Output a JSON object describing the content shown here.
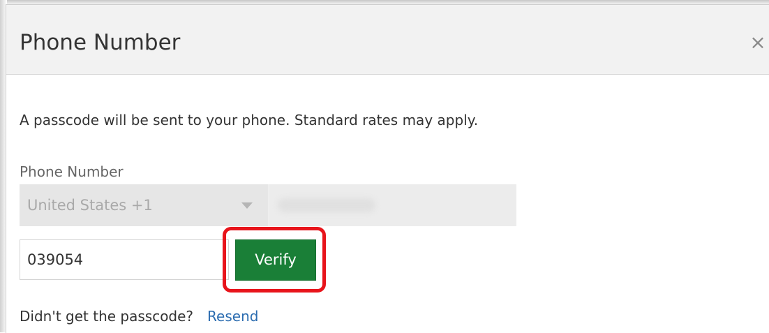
{
  "dialog": {
    "title": "Phone Number",
    "close_icon": "close-icon",
    "close_glyph": "×"
  },
  "info": {
    "text": "A passcode will be sent to your phone. Standard rates may apply."
  },
  "phone": {
    "label": "Phone Number",
    "country_value": "United States +1",
    "number_value": ""
  },
  "passcode": {
    "value": "039054"
  },
  "verify": {
    "label": "Verify",
    "color": "#1a7f37"
  },
  "resend": {
    "prompt": "Didn't get the passcode?",
    "link": "Resend",
    "link_color": "#2b6cb0"
  },
  "highlight_color": "#e8141b"
}
